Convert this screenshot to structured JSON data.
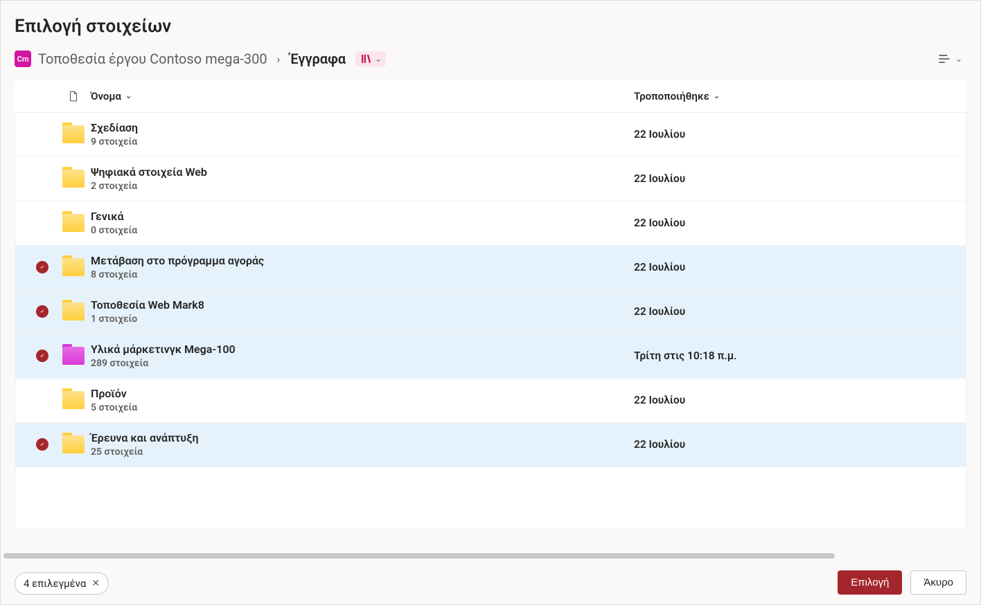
{
  "dialog": {
    "title": "Επιλογή στοιχείων"
  },
  "breadcrumb": {
    "site_initials": "Cm",
    "parent": "Τοποθεσία έργου Contoso mega-300",
    "current": "Έγγραφα"
  },
  "columns": {
    "name": "Όνομα",
    "modified": "Τροποποιήθηκε"
  },
  "rows": [
    {
      "name": "Σχεδίαση",
      "sub": "9 στοιχεία",
      "modified": "22 Ιουλίου",
      "selected": false,
      "color": "yellow"
    },
    {
      "name": "Ψηφιακά στοιχεία Web",
      "sub": "2 στοιχεία",
      "modified": "22 Ιουλίου",
      "selected": false,
      "color": "yellow"
    },
    {
      "name": "Γενικά",
      "sub": "0 στοιχεία",
      "modified": "22 Ιουλίου",
      "selected": false,
      "color": "yellow"
    },
    {
      "name": "Μετάβαση στο πρόγραμμα αγοράς",
      "sub": "8 στοιχεία",
      "modified": "22 Ιουλίου",
      "selected": true,
      "color": "yellow"
    },
    {
      "name": "Τοποθεσία Web Mark8",
      "sub": "1 στοιχείο",
      "modified": "22 Ιουλίου",
      "selected": true,
      "color": "yellow"
    },
    {
      "name": "Υλικά μάρκετινγκ Mega-100",
      "sub": "289 στοιχεία",
      "modified": "Τρίτη στις 10:18 π.μ.",
      "selected": true,
      "color": "pink"
    },
    {
      "name": "Προϊόν",
      "sub": "5 στοιχεία",
      "modified": "22 Ιουλίου",
      "selected": false,
      "color": "yellow"
    },
    {
      "name": "Έρευνα και ανάπτυξη",
      "sub": "25 στοιχεία",
      "modified": "22 Ιουλίου",
      "selected": true,
      "color": "yellow"
    }
  ],
  "footer": {
    "selection_summary": "4 επιλεγμένα",
    "select_label": "Επιλογή",
    "cancel_label": "Άκυρο"
  }
}
